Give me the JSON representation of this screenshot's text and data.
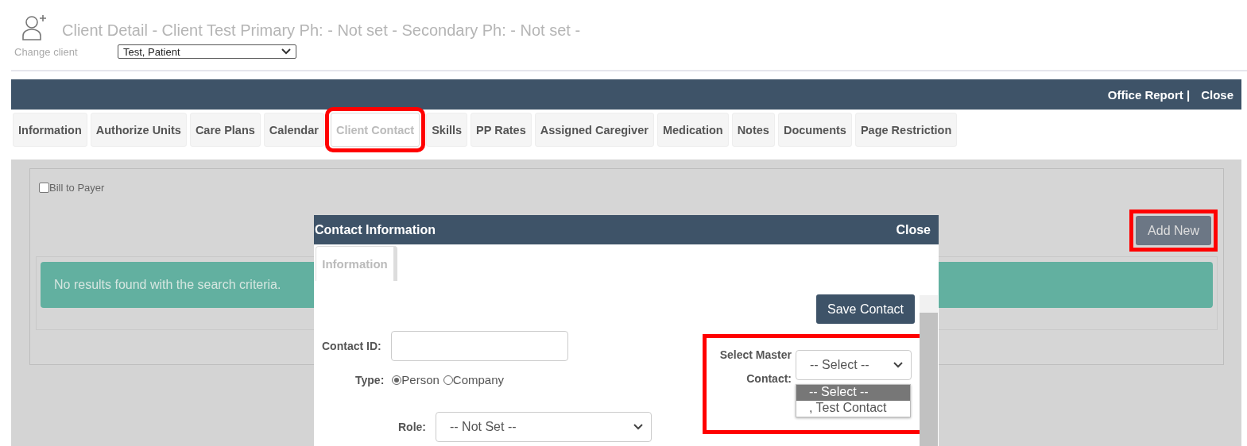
{
  "header": {
    "title": "Client Detail - Client Test Primary Ph: - Not set - Secondary Ph: - Not set -",
    "change_client_label": "Change client",
    "client_select": {
      "value": "Test, Patient"
    }
  },
  "top_bar": {
    "links": [
      "Office Report |",
      "Close"
    ]
  },
  "tabs": [
    {
      "label": "Information",
      "selected": false,
      "highlighted": false
    },
    {
      "label": "Authorize Units",
      "selected": false,
      "highlighted": false
    },
    {
      "label": "Care Plans",
      "selected": false,
      "highlighted": false
    },
    {
      "label": "Calendar",
      "selected": false,
      "highlighted": false
    },
    {
      "label": "Client Contact",
      "selected": true,
      "highlighted": true
    },
    {
      "label": "Skills",
      "selected": false,
      "highlighted": false
    },
    {
      "label": "PP Rates",
      "selected": false,
      "highlighted": false
    },
    {
      "label": "Assigned Caregiver",
      "selected": false,
      "highlighted": false
    },
    {
      "label": "Medication",
      "selected": false,
      "highlighted": false
    },
    {
      "label": "Notes",
      "selected": false,
      "highlighted": false
    },
    {
      "label": "Documents",
      "selected": false,
      "highlighted": false
    },
    {
      "label": "Page Restriction",
      "selected": false,
      "highlighted": false
    }
  ],
  "content": {
    "bill_to_payer": {
      "label": "Bill to Payer",
      "checked": false
    },
    "add_new": {
      "label": "Add New",
      "highlighted": true
    },
    "alert": "No results found with the search criteria."
  },
  "dialog": {
    "title": "Contact Information",
    "close": "Close",
    "tabs": [
      {
        "label": "Information",
        "selected": true
      }
    ],
    "save_button": "Save Contact",
    "contact_id": {
      "label": "Contact ID:"
    },
    "type": {
      "label": "Type:",
      "options": [
        {
          "label": "Person",
          "selected": true
        },
        {
          "label": "Company",
          "selected": false
        }
      ]
    },
    "role": {
      "label": "Role:",
      "value": "-- Not Set --"
    },
    "master_contact": {
      "label": "Select Master Contact:",
      "value": "-- Select --",
      "highlighted": true,
      "open": true,
      "options": [
        {
          "label": "-- Select --",
          "selected": true
        },
        {
          "label": ", Test Contact",
          "selected": false
        }
      ]
    }
  }
}
